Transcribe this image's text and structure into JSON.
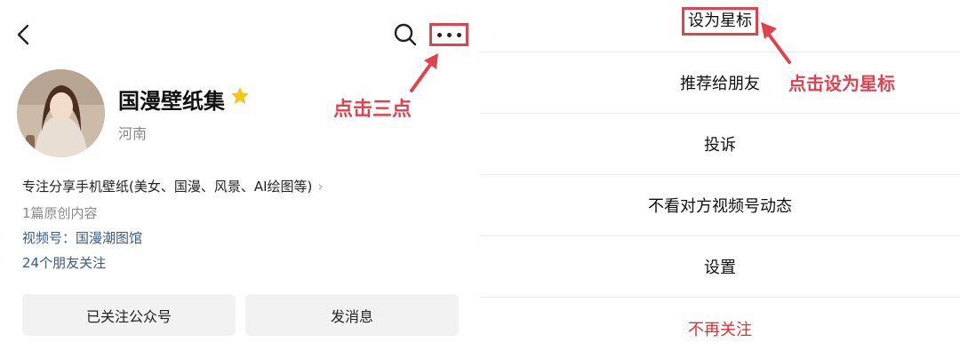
{
  "left": {
    "account_name": "国漫壁纸集",
    "region": "河南",
    "intro": "专注分享手机壁纸(美女、国漫、风景、AI绘图等)",
    "original_count": "1篇原创内容",
    "channel": "视频号：国漫潮图馆",
    "friends_following": "24个朋友关注",
    "buttons": {
      "followed": "已关注公众号",
      "message": "发消息"
    },
    "callout": "点击三点"
  },
  "right": {
    "menu": [
      "设为星标",
      "推荐给朋友",
      "投诉",
      "不看对方视频号动态",
      "设置",
      "不再关注"
    ],
    "callout": "点击设为星标"
  },
  "colors": {
    "annotation": "#e0424f",
    "link": "#3a5a8c",
    "danger": "#e03030",
    "star": "#f5c518"
  }
}
